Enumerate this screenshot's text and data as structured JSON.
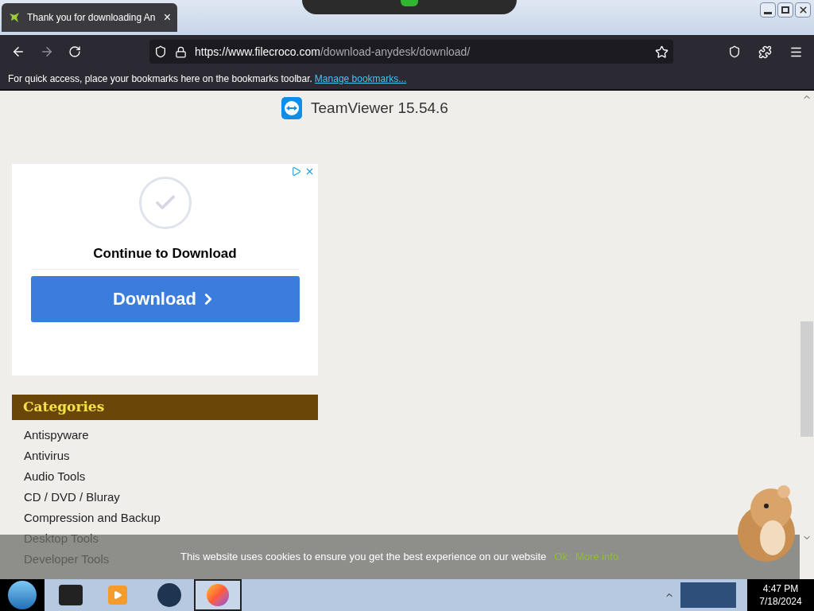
{
  "browser": {
    "tabs": [
      {
        "title": "Thank you for downloading An",
        "selected": true
      }
    ],
    "close_tab": "×",
    "url_host": "https://www.filecroco.com",
    "url_path": "/download-anydesk/download/",
    "bookmarks_hint": "For quick access, place your bookmarks here on the bookmarks toolbar.",
    "bookmarks_link": "Manage bookmarks..."
  },
  "page": {
    "app_title": "TeamViewer 15.54.6",
    "ad": {
      "heading": "Continue to Download",
      "button": "Download"
    },
    "categories": {
      "title": "Categories",
      "items": [
        "Antispyware",
        "Antivirus",
        "Audio Tools",
        "CD / DVD / Bluray",
        "Compression and Backup",
        "Desktop Tools",
        "Developer Tools"
      ]
    },
    "cookie_banner": {
      "message": "This website uses cookies to ensure you get the best experience on our website",
      "ok": "Ok",
      "more": "More info"
    }
  },
  "taskbar": {
    "time": "4:47 PM",
    "date": "7/18/2024"
  }
}
